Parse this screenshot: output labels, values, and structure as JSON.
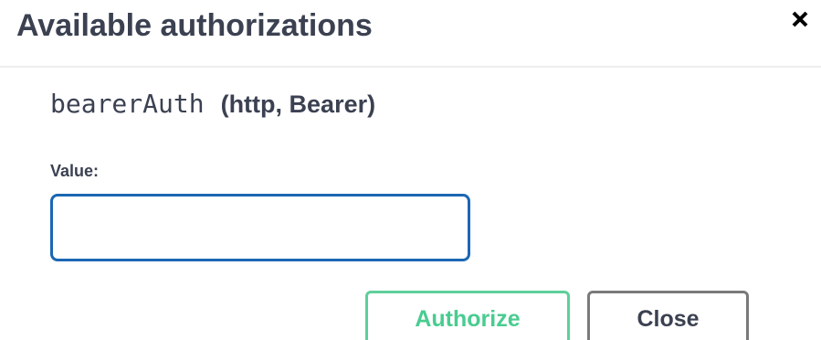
{
  "dialog": {
    "title": "Available authorizations",
    "close_icon": "close-x-icon"
  },
  "scheme": {
    "name": "bearerAuth",
    "type": "(http, Bearer)"
  },
  "value_field": {
    "label": "Value:",
    "value": "",
    "placeholder": ""
  },
  "buttons": {
    "authorize_label": "Authorize",
    "close_label": "Close"
  },
  "colors": {
    "text": "#3b4151",
    "input_border": "#1b67b4",
    "authorize": "#49cc90",
    "close_border": "#7a7a7a"
  }
}
